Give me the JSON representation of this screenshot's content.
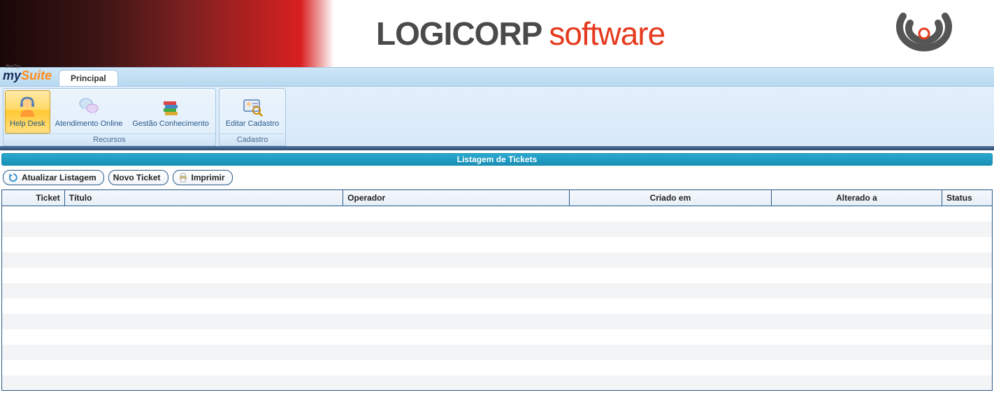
{
  "banner": {
    "brand1": "LOGICORP",
    "brand2": "software"
  },
  "appbar": {
    "suite_my": "my",
    "suite_suite": "Suite",
    "suite_tiny": "BraZip",
    "tab_principal": "Principal"
  },
  "ribbon": {
    "group_recursos": "Recursos",
    "group_cadastro": "Cadastro",
    "helpdesk": "Help Desk",
    "atendimento": "Atendimento Online",
    "gestao": "Gestão Conhecimento",
    "editar": "Editar Cadastro"
  },
  "section": {
    "title": "Listagem de Tickets"
  },
  "toolbar": {
    "atualizar": "Atualizar Listagem",
    "novo": "Novo Ticket",
    "imprimir": "Imprimir"
  },
  "grid": {
    "headers": {
      "ticket": "Ticket",
      "titulo": "Título",
      "operador": "Operador",
      "criado": "Criado em",
      "alterado": "Alterado a",
      "status": "Status"
    },
    "rows": []
  }
}
